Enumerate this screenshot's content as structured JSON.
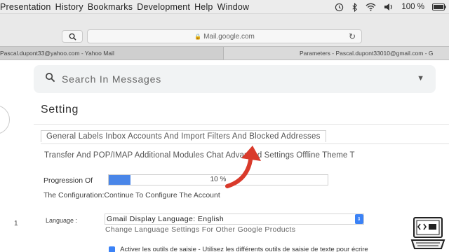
{
  "menubar": {
    "items": [
      "Presentation",
      "History",
      "Bookmarks",
      "Development",
      "Help",
      "Window"
    ],
    "battery": "100 %",
    "icons": [
      "time-machine-icon",
      "bluetooth-icon",
      "wifi-icon",
      "volume-icon",
      "battery-icon"
    ]
  },
  "address_bar": {
    "url": "Mail.google.com"
  },
  "browser_tabs": [
    {
      "label": "Pascal.dupont33@yahoo.com - Yahoo Mail"
    },
    {
      "label": "Parameters - Pascal.dupont33010@gmail.com - G"
    }
  ],
  "gmail": {
    "search_placeholder": "Search In Messages",
    "settings_title": "Setting",
    "settings_tabs_row1": "General Labels Inbox Accounts And Import Filters And Blocked Addresses",
    "settings_tabs_row2": "Transfer And POP/IMAP Additional Modules Chat Advanced Settings Offline Theme T",
    "progress_label": "Progression Of",
    "progress_value": 10,
    "progress_text": "10 %",
    "config_text": "The Configuration:Continue To Configure The Account",
    "row_number": "1",
    "language_label": "Language :",
    "language_select": "Gmail Display Language: English",
    "language_link": "Change Language Settings For Other Google Products",
    "checkbox_text": "Activer les outils de saisie - Utilisez les différents outils de saisie de texte pour écrire"
  },
  "colors": {
    "accent": "#4a86e8",
    "arrow": "#d93a2b"
  }
}
